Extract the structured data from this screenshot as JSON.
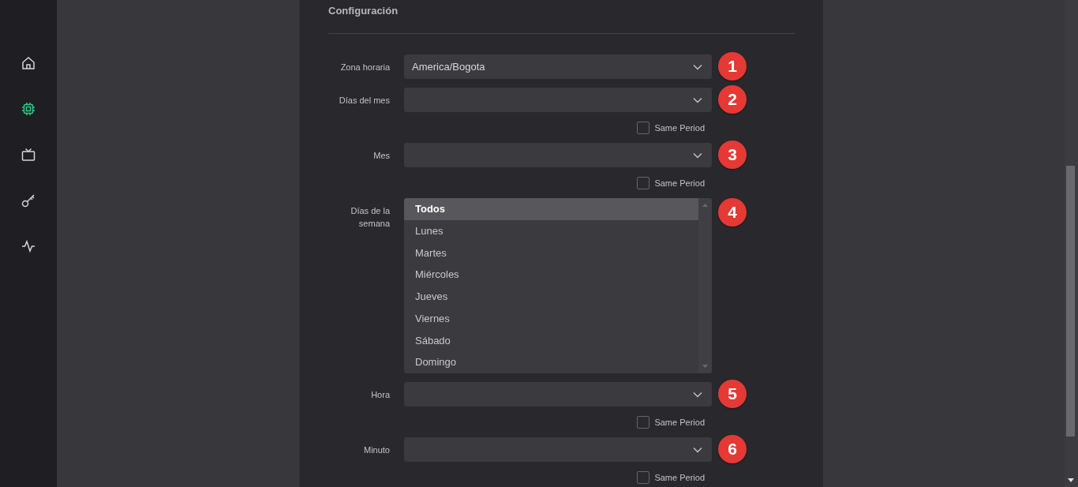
{
  "sidebar": {
    "items": [
      {
        "kind": "home",
        "selected": false
      },
      {
        "kind": "chip",
        "selected": true
      },
      {
        "kind": "tv",
        "selected": false
      },
      {
        "kind": "key",
        "selected": false
      },
      {
        "kind": "activity",
        "selected": false
      }
    ]
  },
  "panel": {
    "title": "Configuración",
    "fields": [
      {
        "kind": "select",
        "label": "Zona horaria",
        "value": "America/Bogota",
        "badge": "1"
      },
      {
        "kind": "select",
        "label": "Días del mes",
        "badge": "2",
        "same_period": {
          "label": "Same Period",
          "checked": false
        }
      },
      {
        "kind": "select",
        "label": "Mes",
        "badge": "3",
        "same_period": {
          "label": "Same Period",
          "checked": false
        }
      },
      {
        "kind": "listbox",
        "label": "Días de la semana",
        "badge": "4",
        "options": [
          {
            "label": "Todos",
            "selected": true
          },
          {
            "label": "Lunes",
            "selected": false
          },
          {
            "label": "Martes",
            "selected": false
          },
          {
            "label": "Miércoles",
            "selected": false
          },
          {
            "label": "Jueves",
            "selected": false
          },
          {
            "label": "Viernes",
            "selected": false
          },
          {
            "label": "Sábado",
            "selected": false
          },
          {
            "label": "Domingo",
            "selected": false
          }
        ]
      },
      {
        "kind": "select",
        "label": "Hora",
        "badge": "5",
        "same_period": {
          "label": "Same Period",
          "checked": false
        }
      },
      {
        "kind": "select",
        "label": "Minuto",
        "badge": "6",
        "same_period": {
          "label": "Same Period",
          "checked": false
        }
      }
    ]
  }
}
